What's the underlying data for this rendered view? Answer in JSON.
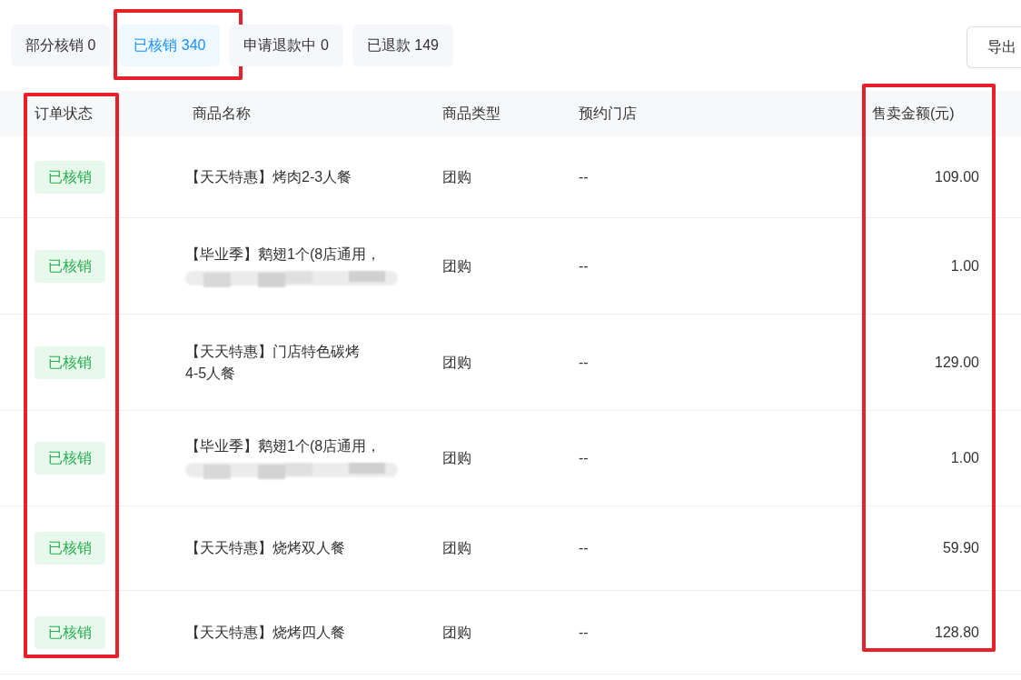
{
  "tabs": [
    {
      "label": "部分核销 0",
      "selected": false,
      "highlighted": false
    },
    {
      "label": "已核销 340",
      "selected": true,
      "highlighted": true
    },
    {
      "label": "申请退款中 0",
      "selected": false,
      "highlighted": false
    },
    {
      "label": "已退款 149",
      "selected": false,
      "highlighted": false
    }
  ],
  "export_button": {
    "label": "导出"
  },
  "table": {
    "columns": [
      {
        "label": "订单状态",
        "highlighted": true
      },
      {
        "label": "商品名称",
        "highlighted": false
      },
      {
        "label": "商品类型",
        "highlighted": false
      },
      {
        "label": "预约门店",
        "highlighted": false
      },
      {
        "label": "售卖金额(元)",
        "highlighted": true
      }
    ],
    "rows": [
      {
        "status": "已核销",
        "name": "【天天特惠】烤肉2-3人餐",
        "redacted": false,
        "type": "团购",
        "store": "--",
        "amount": "109.00"
      },
      {
        "status": "已核销",
        "name": "【毕业季】鹅翅1个(8店通用，",
        "redacted": true,
        "type": "团购",
        "store": "--",
        "amount": "1.00"
      },
      {
        "status": "已核销",
        "name": "【天天特惠】门店特色碳烤4-5人餐",
        "redacted": false,
        "type": "团购",
        "store": "--",
        "amount": "129.00"
      },
      {
        "status": "已核销",
        "name": "【毕业季】鹅翅1个(8店通用，",
        "redacted": true,
        "type": "团购",
        "store": "--",
        "amount": "1.00"
      },
      {
        "status": "已核销",
        "name": "【天天特惠】烧烤双人餐",
        "redacted": false,
        "type": "团购",
        "store": "--",
        "amount": "59.90"
      },
      {
        "status": "已核销",
        "name": "【天天特惠】烧烤四人餐",
        "redacted": false,
        "type": "团购",
        "store": "--",
        "amount": "128.80"
      }
    ]
  }
}
